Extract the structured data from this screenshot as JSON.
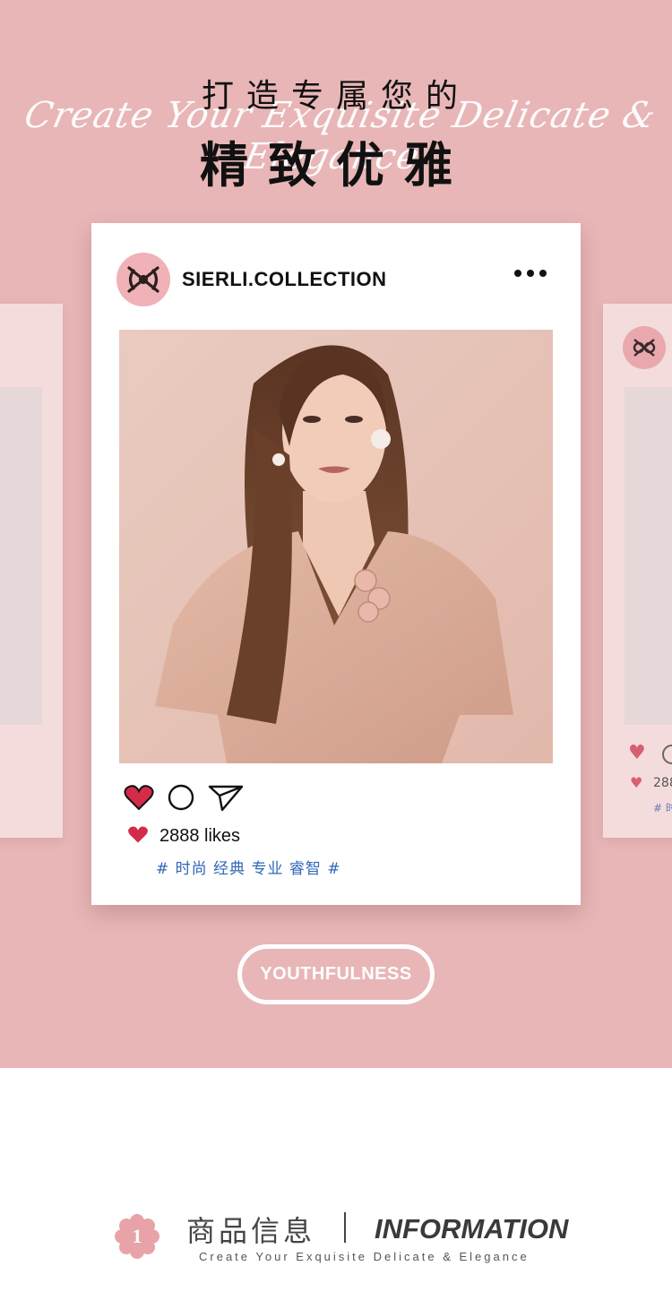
{
  "hero": {
    "title_line1": "打造专属您的",
    "title_line2": "精致优雅",
    "script_text": "Create Your Exquisite Delicate & Elegance",
    "background_color": "#e8b6b7"
  },
  "post": {
    "username": "SIERLI.COLLECTION",
    "logo_icon": "sierli-monogram-logo",
    "more_icon": "more-dots-icon",
    "photo_description_icon": "model-photo",
    "actions": [
      "heart-icon",
      "comment-icon",
      "send-icon"
    ],
    "likes": "2888 likes",
    "tags": "# 时尚 经典 专业 睿智 #",
    "heart_color": "#d42b48",
    "tag_color": "#3167b8"
  },
  "side_right": {
    "likes": "288",
    "tag": "# 时"
  },
  "badge": {
    "label": "YOUTHFULNESS"
  },
  "footer": {
    "number": "1",
    "title_cn": "商品信息",
    "title_en": "INFORMATION",
    "subtitle": "Create Your Exquisite Delicate & Elegance"
  }
}
